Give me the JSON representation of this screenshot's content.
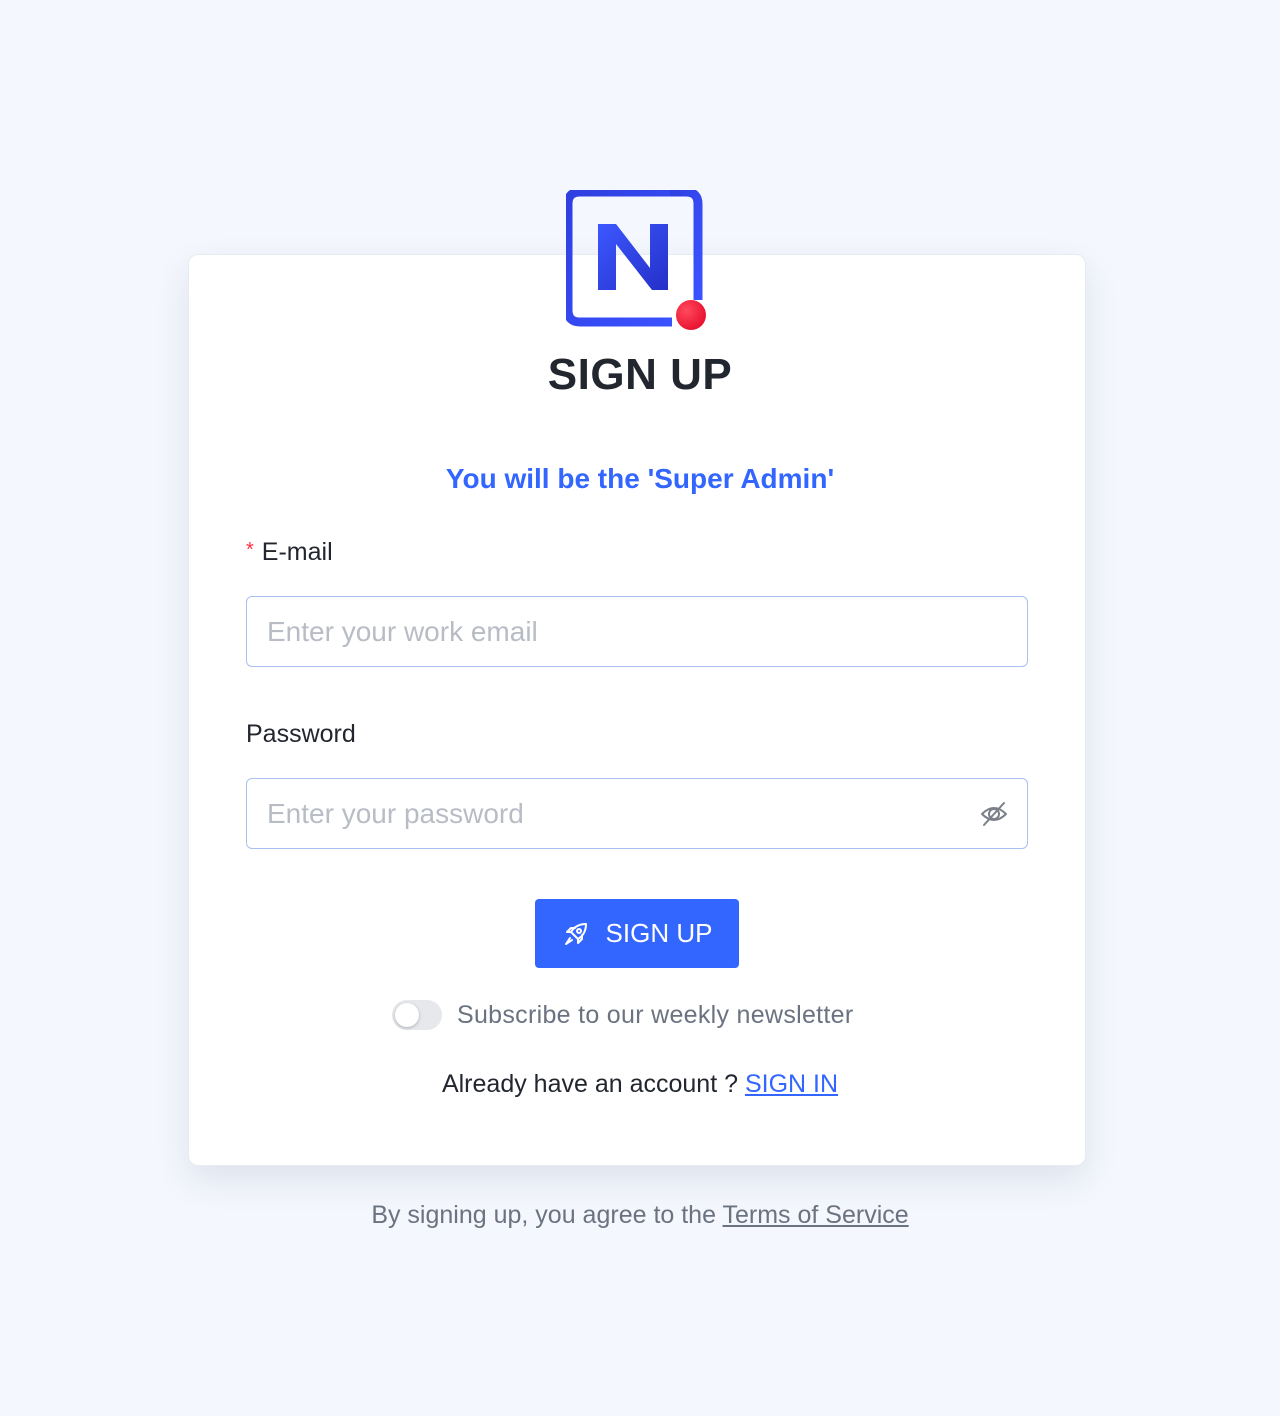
{
  "brand": {
    "logo_icon": "n-logo-icon",
    "primary_color": "#3366ff",
    "accent_color": "#ff1f44"
  },
  "form": {
    "title": "SIGN UP",
    "subtitle": "You will be the 'Super Admin'",
    "email": {
      "required_mark": "*",
      "label": "E-mail",
      "placeholder": "Enter your work email",
      "value": ""
    },
    "password": {
      "label": "Password",
      "placeholder": "Enter your password",
      "value": "",
      "toggle_icon": "eye-slash-icon"
    },
    "submit": {
      "icon": "rocket-icon",
      "label": "SIGN UP"
    },
    "newsletter": {
      "label": "Subscribe to our weekly newsletter",
      "checked": false
    },
    "signin": {
      "prompt": "Already have an account ?",
      "link_label": "SIGN IN"
    }
  },
  "footer": {
    "terms_prompt": "By signing up, you agree to the",
    "terms_link_label": "Terms of Service"
  }
}
